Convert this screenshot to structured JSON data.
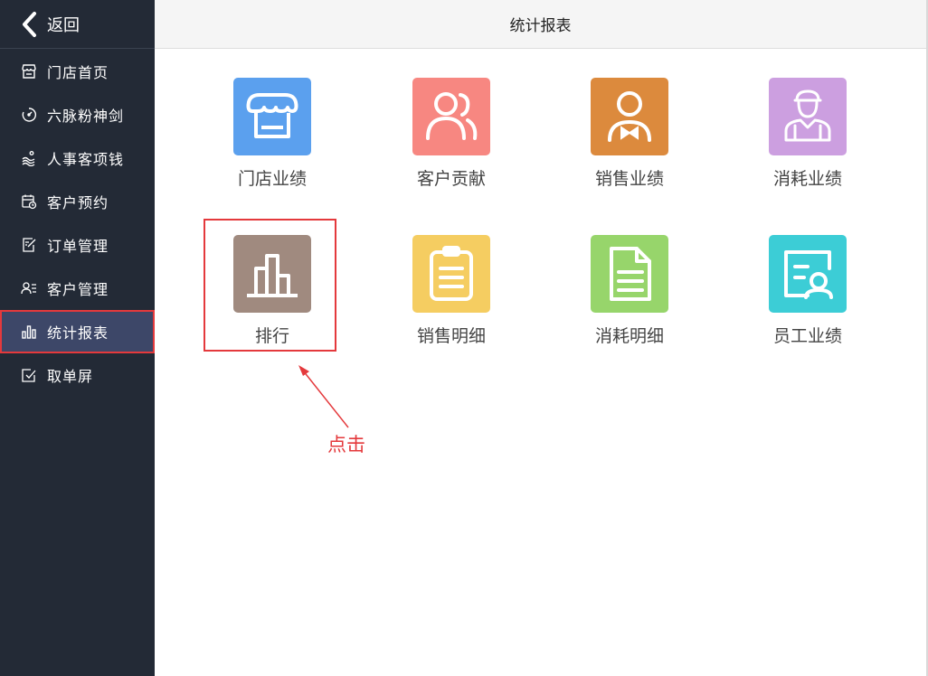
{
  "sidebar": {
    "back_label": "返回",
    "items": [
      {
        "label": "门店首页",
        "icon": "store-icon"
      },
      {
        "label": "六脉粉神剑",
        "icon": "timer-icon"
      },
      {
        "label": "人事客项钱",
        "icon": "wave-icon"
      },
      {
        "label": "客户预约",
        "icon": "calendar-clock-icon"
      },
      {
        "label": "订单管理",
        "icon": "edit-icon"
      },
      {
        "label": "客户管理",
        "icon": "user-list-icon"
      },
      {
        "label": "统计报表",
        "icon": "bar-chart-icon",
        "active": true
      },
      {
        "label": "取单屏",
        "icon": "check-box-icon"
      }
    ]
  },
  "header": {
    "title": "统计报表"
  },
  "tiles": [
    {
      "label": "门店业绩",
      "icon": "store-awning-icon",
      "color": "#5ba0ee"
    },
    {
      "label": "客户贡献",
      "icon": "users-icon",
      "color": "#f78781"
    },
    {
      "label": "销售业绩",
      "icon": "waiter-icon",
      "color": "#dc8a3d"
    },
    {
      "label": "消耗业绩",
      "icon": "worker-icon",
      "color": "#cc9fe0"
    },
    {
      "label": "排行",
      "icon": "ranking-bar-icon",
      "color": "#a08a7f"
    },
    {
      "label": "销售明细",
      "icon": "clipboard-icon",
      "color": "#f5cd61"
    },
    {
      "label": "消耗明细",
      "icon": "document-icon",
      "color": "#97d56b"
    },
    {
      "label": "员工业绩",
      "icon": "employee-card-icon",
      "color": "#3ccdd6"
    }
  ],
  "annotation": {
    "text": "点击",
    "color": "#e4393c"
  },
  "colors": {
    "sidebar_bg": "#232a36",
    "active_bg": "#3d4768",
    "highlight": "#e4393c"
  }
}
